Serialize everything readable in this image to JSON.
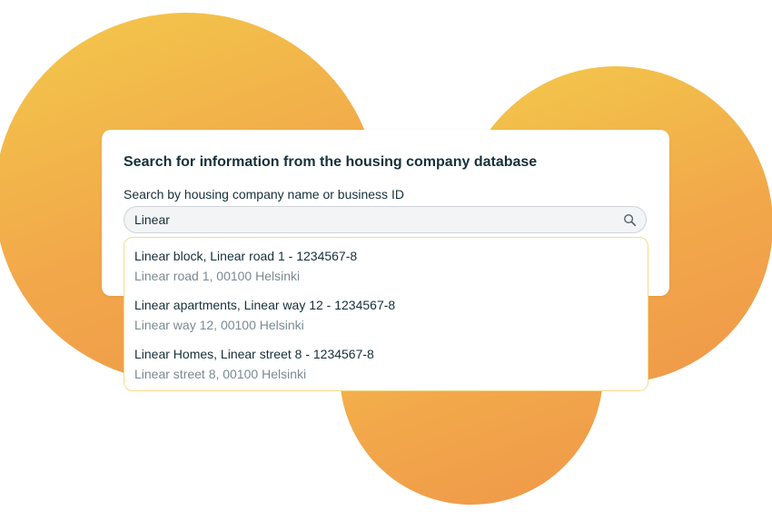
{
  "card": {
    "title": "Search for information from the housing company database",
    "search_label": "Search by housing company name or business ID",
    "search_value": "Linear"
  },
  "results": [
    {
      "title": "Linear block, Linear road 1 - 1234567-8",
      "address": "Linear road 1, 00100 Helsinki"
    },
    {
      "title": "Linear apartments, Linear way 12 - 1234567-8",
      "address": "Linear way 12, 00100 Helsinki"
    },
    {
      "title": "Linear Homes, Linear street 8 - 1234567-8",
      "address": "Linear street 8, 00100 Helsinki"
    }
  ],
  "icons": {
    "search": "search-icon"
  },
  "colors": {
    "accent_gradient_start": "#f3c94b",
    "accent_gradient_end": "#f0984a",
    "text_primary": "#16303a",
    "text_secondary": "#7b8a92"
  }
}
